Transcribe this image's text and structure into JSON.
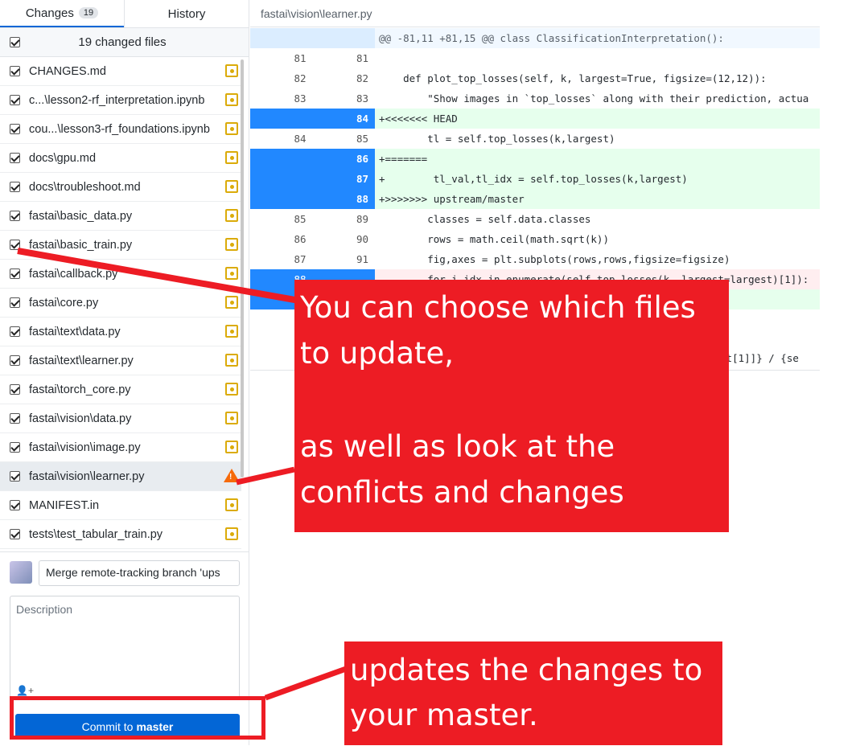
{
  "tabs": {
    "changes_label": "Changes",
    "changes_count": "19",
    "history_label": "History"
  },
  "select_all": {
    "label": "19 changed files",
    "checked": true
  },
  "files": [
    {
      "name": "CHANGES.md",
      "status": "modified"
    },
    {
      "name": "c...\\lesson2-rf_interpretation.ipynb",
      "status": "modified"
    },
    {
      "name": "cou...\\lesson3-rf_foundations.ipynb",
      "status": "modified"
    },
    {
      "name": "docs\\gpu.md",
      "status": "modified"
    },
    {
      "name": "docs\\troubleshoot.md",
      "status": "modified"
    },
    {
      "name": "fastai\\basic_data.py",
      "status": "modified"
    },
    {
      "name": "fastai\\basic_train.py",
      "status": "modified"
    },
    {
      "name": "fastai\\callback.py",
      "status": "modified"
    },
    {
      "name": "fastai\\core.py",
      "status": "modified"
    },
    {
      "name": "fastai\\text\\data.py",
      "status": "modified"
    },
    {
      "name": "fastai\\text\\learner.py",
      "status": "modified"
    },
    {
      "name": "fastai\\torch_core.py",
      "status": "modified"
    },
    {
      "name": "fastai\\vision\\data.py",
      "status": "modified"
    },
    {
      "name": "fastai\\vision\\image.py",
      "status": "modified"
    },
    {
      "name": "fastai\\vision\\learner.py",
      "status": "conflict"
    },
    {
      "name": "MANIFEST.in",
      "status": "modified"
    },
    {
      "name": "tests\\test_tabular_train.py",
      "status": "modified"
    }
  ],
  "commit": {
    "summary_value": "Merge remote-tracking branch 'ups",
    "description_placeholder": "Description",
    "button_prefix": "Commit to",
    "button_branch": "master"
  },
  "diff": {
    "file_path": "fastai\\vision\\learner.py",
    "hunk_header": "@@ -81,11 +81,15 @@ class ClassificationInterpretation():",
    "lines": [
      {
        "type": "context",
        "old": "81",
        "new": "81",
        "code": ""
      },
      {
        "type": "context",
        "old": "82",
        "new": "82",
        "code": "    def plot_top_losses(self, k, largest=True, figsize=(12,12)):"
      },
      {
        "type": "context",
        "old": "83",
        "new": "83",
        "code": "        \"Show images in `top_losses` along with their prediction, actua"
      },
      {
        "type": "added",
        "old": "",
        "new": "84",
        "code": "+<<<<<<< HEAD"
      },
      {
        "type": "context",
        "old": "84",
        "new": "85",
        "code": "        tl = self.top_losses(k,largest)"
      },
      {
        "type": "added",
        "old": "",
        "new": "86",
        "code": "+======="
      },
      {
        "type": "added",
        "old": "",
        "new": "87",
        "code": "+        tl_val,tl_idx = self.top_losses(k,largest)"
      },
      {
        "type": "added",
        "old": "",
        "new": "88",
        "code": "+>>>>>>> upstream/master"
      },
      {
        "type": "context",
        "old": "85",
        "new": "89",
        "code": "        classes = self.data.classes"
      },
      {
        "type": "context",
        "old": "86",
        "new": "90",
        "code": "        rows = math.ceil(math.sqrt(k))"
      },
      {
        "type": "context",
        "old": "87",
        "new": "91",
        "code": "        fig,axes = plt.subplots(rows,rows,figsize=figsize)"
      },
      {
        "type": "removed",
        "old": "88",
        "new": "",
        "code": "-       for i,idx in enumerate(self.top_losses(k, largest=largest)[1]):"
      },
      {
        "type": "added",
        "old": "",
        "new": "",
        "code": ""
      }
    ],
    "tail_code": "es[t[1]]} / {se"
  },
  "annotations": {
    "callout1_line1": "You can choose which files",
    "callout1_line2": "to update,",
    "callout1_line3": "as well as look at the",
    "callout1_line4": "conflicts and changes",
    "callout2_line1": "updates the changes to",
    "callout2_line2": "your master.",
    "color": "#ed1c24"
  },
  "colors": {
    "accent_blue": "#0366d6",
    "modified_yellow": "#dbab09",
    "conflict_orange": "#f66a0a"
  }
}
